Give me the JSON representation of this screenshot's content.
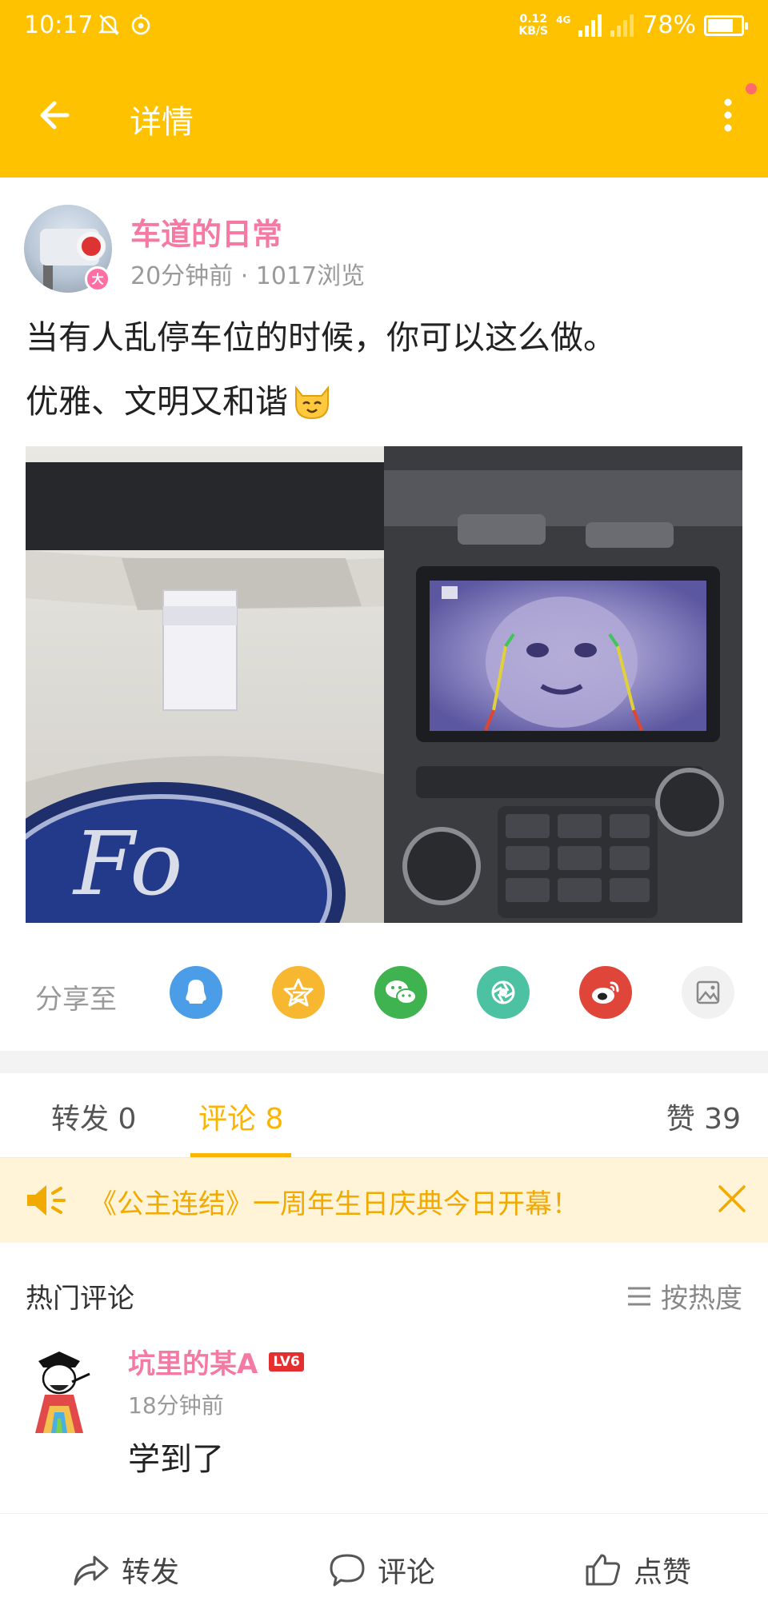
{
  "status_bar": {
    "time": "10:17",
    "speed_value": "0.12",
    "speed_unit": "KB/S",
    "network": "4G",
    "battery_pct": "78%",
    "battery_level": 0.78
  },
  "app_bar": {
    "title": "详情"
  },
  "post": {
    "author": "车道的日常",
    "verified_badge": "大",
    "meta": "20分钟前 · 1017浏览",
    "text_line1": "当有人乱停车位的时候，你可以这么做。",
    "text_line2": "优雅、文明又和谐"
  },
  "share": {
    "label": "分享至",
    "targets": [
      {
        "name": "qq",
        "color": "#4a9de6"
      },
      {
        "name": "qzone",
        "color": "#f7b731"
      },
      {
        "name": "wechat",
        "color": "#3fb34f"
      },
      {
        "name": "moments",
        "color": "#4cc2a2"
      },
      {
        "name": "weibo",
        "color": "#e0453a"
      },
      {
        "name": "save-image",
        "color": "#f1f1f1"
      }
    ]
  },
  "tabs": {
    "repost": "转发 0",
    "comments": "评论 8",
    "likes": "赞 39"
  },
  "notice": {
    "text": "《公主连结》一周年生日庆典今日开幕！"
  },
  "comments": {
    "section_title": "热门评论",
    "sort_label": "按热度",
    "items": [
      {
        "user": "坑里的某A",
        "level": "LV6",
        "time": "18分钟前",
        "text": "学到了"
      }
    ]
  },
  "bottom_bar": {
    "repost": "转发",
    "comment": "评论",
    "like": "点赞"
  },
  "colors": {
    "brand_yellow": "#fec200",
    "accent_pink": "#f47aa3",
    "tab_active": "#fbb400",
    "notice_bg": "#fff4d8"
  }
}
